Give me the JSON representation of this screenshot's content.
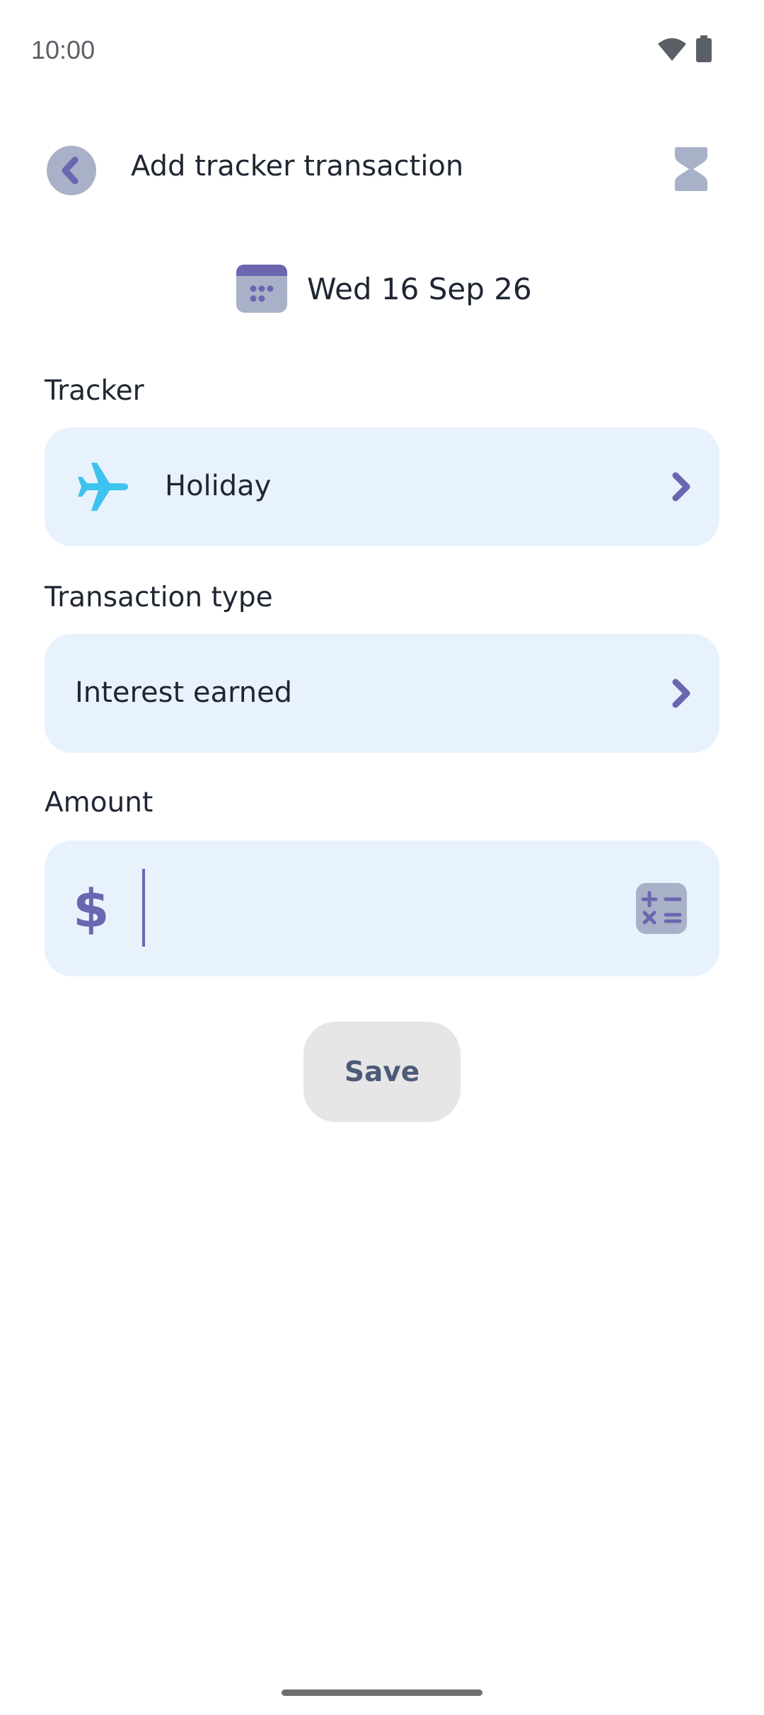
{
  "status_bar": {
    "time": "10:00",
    "icons": [
      "wifi-icon",
      "battery-icon"
    ]
  },
  "header": {
    "title": "Add tracker transaction",
    "back_icon": "chevron-left-icon",
    "action_icon": "hourglass-icon"
  },
  "date": {
    "text": "Wed 16 Sep 26",
    "icon": "calendar-icon"
  },
  "tracker": {
    "label": "Tracker",
    "value": "Holiday",
    "icon": "airplane-icon"
  },
  "transaction_type": {
    "label": "Transaction type",
    "value": "Interest earned"
  },
  "amount": {
    "label": "Amount",
    "currency_symbol": "$",
    "value": "",
    "calculator_icon": "calculator-icon"
  },
  "save": {
    "label": "Save"
  },
  "colors": {
    "accent": "#6b66b0",
    "field_bg": "#e8f2fd",
    "muted_icon": "#a9b1c8",
    "plane": "#3ec3ef",
    "save_bg": "#e6e6e6",
    "save_text": "#4e5b78"
  }
}
